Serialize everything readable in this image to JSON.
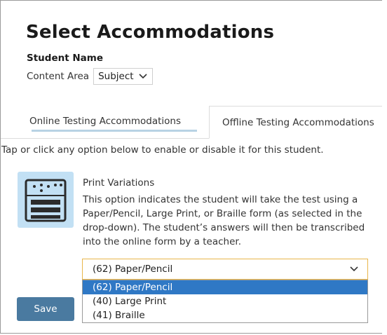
{
  "page": {
    "title": "Select Accommodations",
    "student_name_label": "Student Name",
    "content_area_label": "Content Area",
    "subject_value": "Subject"
  },
  "tabs": [
    {
      "label": "Online Testing Accommodations",
      "active": false
    },
    {
      "label": "Offline Testing Accommodations",
      "active": true
    }
  ],
  "instructions": "Tap or click any option below to enable or disable it for this student.",
  "option": {
    "icon": "braille-print-icon",
    "title": "Print Variations",
    "description_lines": [
      "This option indicates the student will take the test using a",
      "Paper/Pencil, Large Print, or Braille form (as selected in the",
      "drop-down). The student’s answers will then be transcribed",
      "into the online form by a teacher."
    ],
    "select_value": "(62) Paper/Pencil",
    "select_options": [
      {
        "label": "(62) Paper/Pencil",
        "highlighted": true
      },
      {
        "label": "(40) Large Print",
        "highlighted": false
      },
      {
        "label": "(41) Braille",
        "highlighted": false
      }
    ]
  },
  "save_label": "Save",
  "colors": {
    "accent_blue": "#2f78c5",
    "icon_bg": "#c2e0f4",
    "focus_border": "#e9b64a",
    "button": "#4a7aa0",
    "tab_underline": "#b8d3e4"
  }
}
